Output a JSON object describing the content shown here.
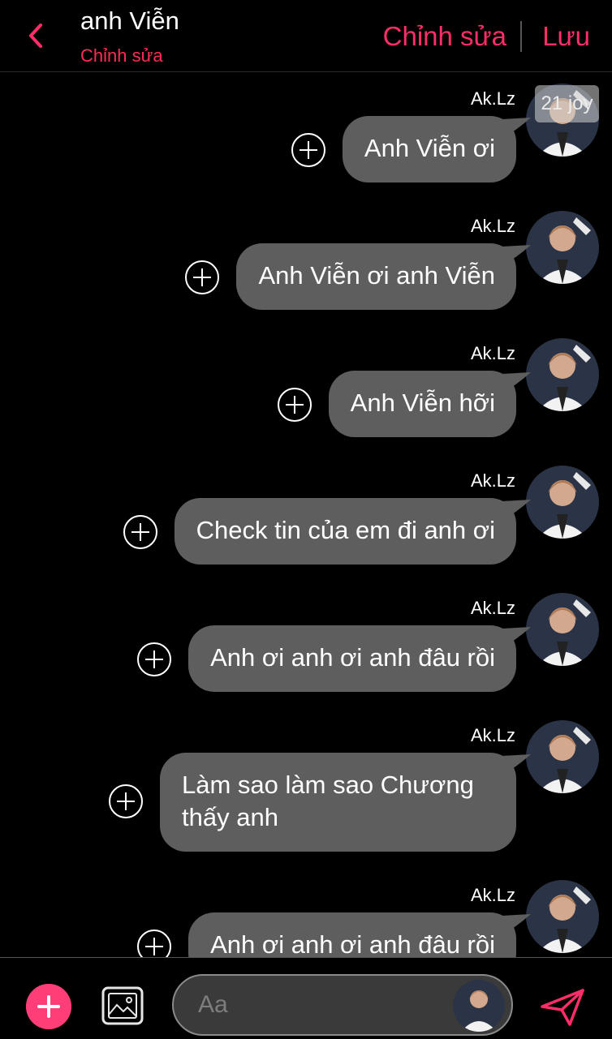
{
  "header": {
    "title": "anh Viễn",
    "subtitle": "Chỉnh sửa",
    "edit_label": "Chỉnh sửa",
    "save_label": "Lưu"
  },
  "badge": {
    "text": "21 joy"
  },
  "messages": [
    {
      "sender": "Ak.Lz",
      "text": "Anh Viễn ơi"
    },
    {
      "sender": "Ak.Lz",
      "text": "Anh Viễn ơi anh Viễn"
    },
    {
      "sender": "Ak.Lz",
      "text": "Anh Viễn hỡi"
    },
    {
      "sender": "Ak.Lz",
      "text": "Check tin của em đi anh ơi"
    },
    {
      "sender": "Ak.Lz",
      "text": "Anh ơi anh ơi anh đâu rồi"
    },
    {
      "sender": "Ak.Lz",
      "text": "Làm sao làm sao Chương thấy anh"
    },
    {
      "sender": "Ak.Lz",
      "text": "Anh ơi anh ơi anh đâu rồi"
    }
  ],
  "composer": {
    "placeholder": "Aa"
  },
  "colors": {
    "accent": "#ff2d68",
    "bubble": "#5e5e5e",
    "background": "#000000"
  }
}
